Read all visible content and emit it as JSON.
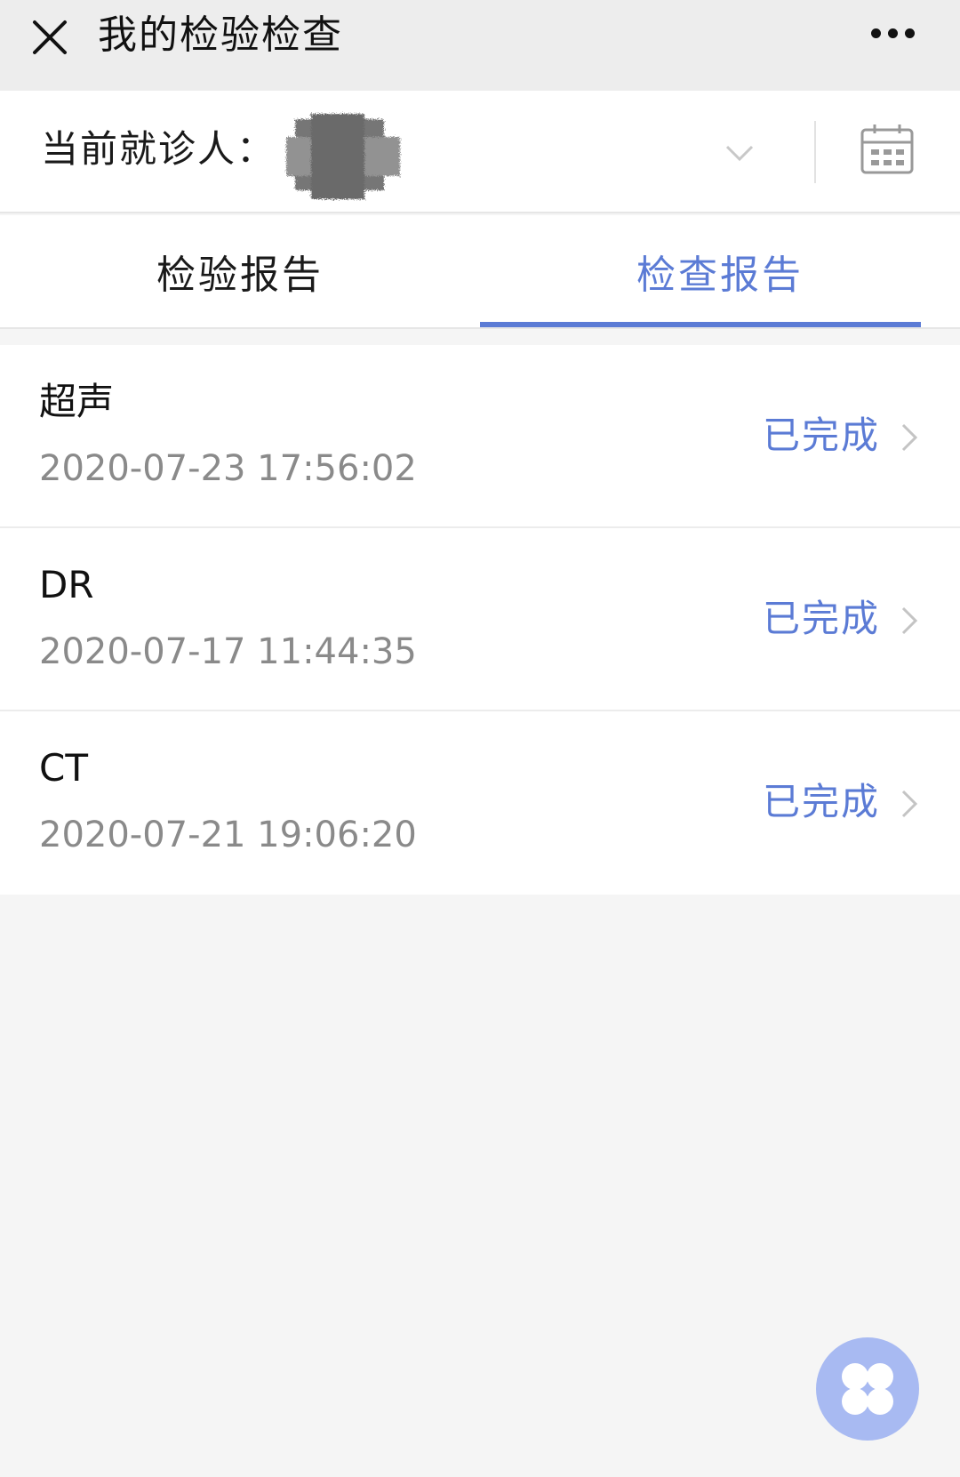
{
  "topbar": {
    "title": "我的检验检查",
    "close_icon": "close-icon",
    "more_icon": "more-dots-icon"
  },
  "patient": {
    "label": "当前就诊人：",
    "dropdown_icon": "chevron-down-icon",
    "calendar_icon": "calendar-icon"
  },
  "tabs": [
    {
      "label": "检验报告",
      "active": false
    },
    {
      "label": "检查报告",
      "active": true
    }
  ],
  "reports": [
    {
      "name": "超声",
      "time": "2020-07-23 17:56:02",
      "status": "已完成"
    },
    {
      "name": "DR",
      "time": "2020-07-17 11:44:35",
      "status": "已完成"
    },
    {
      "name": "CT",
      "time": "2020-07-21 19:06:20",
      "status": "已完成"
    }
  ],
  "fab": {
    "icon": "clover-menu-icon"
  },
  "colors": {
    "accent": "#5b7bd5",
    "fab": "#a8baf2",
    "background": "#f5f5f5"
  }
}
